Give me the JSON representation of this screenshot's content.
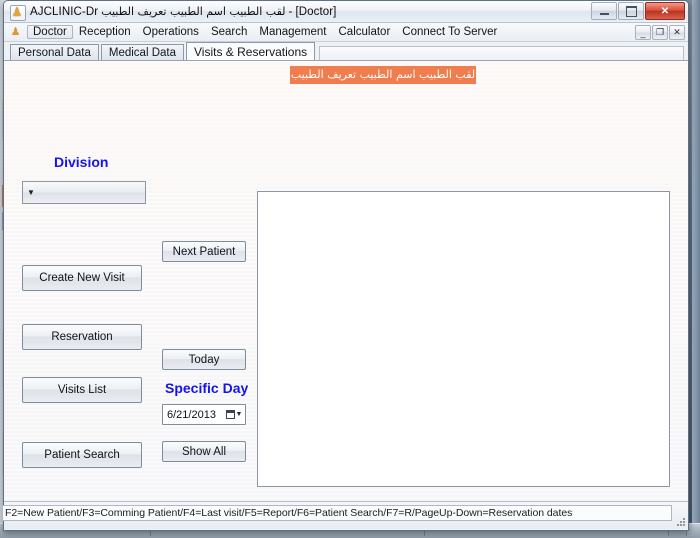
{
  "window": {
    "title_app": "AJCLINIC-Dr",
    "title_arabic": "لقب الطبيب اسم الطبيب تعريف الطبيب",
    "title_suffix": "- [Doctor]",
    "app_icon": "tooth-icon",
    "buttons": {
      "minimize": "minimize-icon",
      "maximize": "maximize-icon",
      "close": "✕"
    }
  },
  "menubar": {
    "icon": "tooth-icon",
    "items": [
      {
        "label": "Doctor",
        "active": true
      },
      {
        "label": "Reception",
        "active": false
      },
      {
        "label": "Operations",
        "active": false
      },
      {
        "label": "Search",
        "active": false
      },
      {
        "label": "Management",
        "active": false
      },
      {
        "label": "Calculator",
        "active": false
      },
      {
        "label": "Connect To Server",
        "active": false
      }
    ],
    "mdi_buttons": {
      "minimize": "_",
      "restore": "❐",
      "close": "✕"
    }
  },
  "tabs": [
    {
      "label": "Personal Data",
      "selected": false
    },
    {
      "label": "Medical Data",
      "selected": false
    },
    {
      "label": "Visits & Reservations",
      "selected": true
    }
  ],
  "banner": {
    "text": "لقب الطبيب اسم الطبيب تعريف الطبيب",
    "background_color": "#ef7d4e",
    "text_color": "#ffffff"
  },
  "form": {
    "division_label": "Division",
    "division_value": "",
    "division_arrow": "▼",
    "specific_day_label": "Specific Day",
    "date_value": "6/21/2013",
    "date_dropdown_arrow": "▼",
    "accent_label_color": "#1414f0",
    "buttons": {
      "create_new_visit": "Create New Visit",
      "reservation": "Reservation",
      "visits_list": "Visits List",
      "patient_search": "Patient Search",
      "next_patient": "Next Patient",
      "today": "Today",
      "show_all": "Show All"
    }
  },
  "visits_panel": {
    "items": []
  },
  "statusbar": {
    "text": "F2=New Patient/F3=Comming Patient/F4=Last visit/F5=Report/F6=Patient Search/F7=R/PageUp-Down=Reservation dates"
  }
}
